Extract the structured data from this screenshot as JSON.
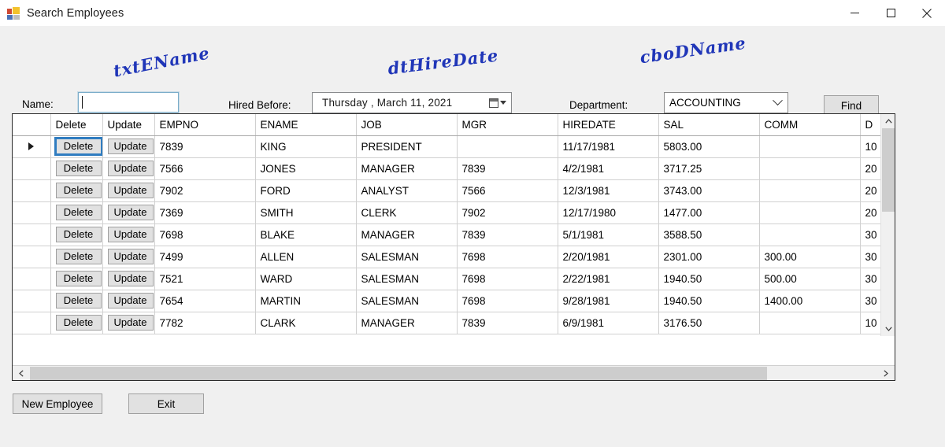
{
  "window": {
    "title": "Search Employees",
    "icon": "winforms-app-icon",
    "controls": {
      "minimize": "minimize-icon",
      "maximize": "maximize-icon",
      "close": "close-icon"
    }
  },
  "search_bar": {
    "name_label": "Name:",
    "name_value": "",
    "hired_before_label": "Hired Before:",
    "hire_date_value": "Thursday ,    March    11, 2021",
    "department_label": "Department:",
    "department_value": "ACCOUNTING",
    "find_label": "Find"
  },
  "annotations": [
    {
      "text": "txtEName",
      "color": "#2036b8"
    },
    {
      "text": "dtHireDate",
      "color": "#2036b8"
    },
    {
      "text": "cboDName",
      "color": "#2036b8"
    }
  ],
  "grid": {
    "columns": [
      "Delete",
      "Update",
      "EMPNO",
      "ENAME",
      "JOB",
      "MGR",
      "HIREDATE",
      "SAL",
      "COMM",
      "D"
    ],
    "row_action_labels": {
      "delete": "Delete",
      "update": "Update"
    },
    "selected_row_index": 0,
    "rows": [
      {
        "empno": "7839",
        "ename": "KING",
        "job": "PRESIDENT",
        "mgr": "",
        "hiredate": "11/17/1981",
        "sal": "5803.00",
        "comm": "",
        "deptno": "10"
      },
      {
        "empno": "7566",
        "ename": "JONES",
        "job": "MANAGER",
        "mgr": "7839",
        "hiredate": "4/2/1981",
        "sal": "3717.25",
        "comm": "",
        "deptno": "20"
      },
      {
        "empno": "7902",
        "ename": "FORD",
        "job": "ANALYST",
        "mgr": "7566",
        "hiredate": "12/3/1981",
        "sal": "3743.00",
        "comm": "",
        "deptno": "20"
      },
      {
        "empno": "7369",
        "ename": "SMITH",
        "job": "CLERK",
        "mgr": "7902",
        "hiredate": "12/17/1980",
        "sal": "1477.00",
        "comm": "",
        "deptno": "20"
      },
      {
        "empno": "7698",
        "ename": "BLAKE",
        "job": "MANAGER",
        "mgr": "7839",
        "hiredate": "5/1/1981",
        "sal": "3588.50",
        "comm": "",
        "deptno": "30"
      },
      {
        "empno": "7499",
        "ename": "ALLEN",
        "job": "SALESMAN",
        "mgr": "7698",
        "hiredate": "2/20/1981",
        "sal": "2301.00",
        "comm": "300.00",
        "deptno": "30"
      },
      {
        "empno": "7521",
        "ename": "WARD",
        "job": "SALESMAN",
        "mgr": "7698",
        "hiredate": "2/22/1981",
        "sal": "1940.50",
        "comm": "500.00",
        "deptno": "30"
      },
      {
        "empno": "7654",
        "ename": "MARTIN",
        "job": "SALESMAN",
        "mgr": "7698",
        "hiredate": "9/28/1981",
        "sal": "1940.50",
        "comm": "1400.00",
        "deptno": "30"
      },
      {
        "empno": "7782",
        "ename": "CLARK",
        "job": "MANAGER",
        "mgr": "7839",
        "hiredate": "6/9/1981",
        "sal": "3176.50",
        "comm": "",
        "deptno": "10"
      }
    ]
  },
  "footer": {
    "new_employee_label": "New Employee",
    "exit_label": "Exit"
  }
}
